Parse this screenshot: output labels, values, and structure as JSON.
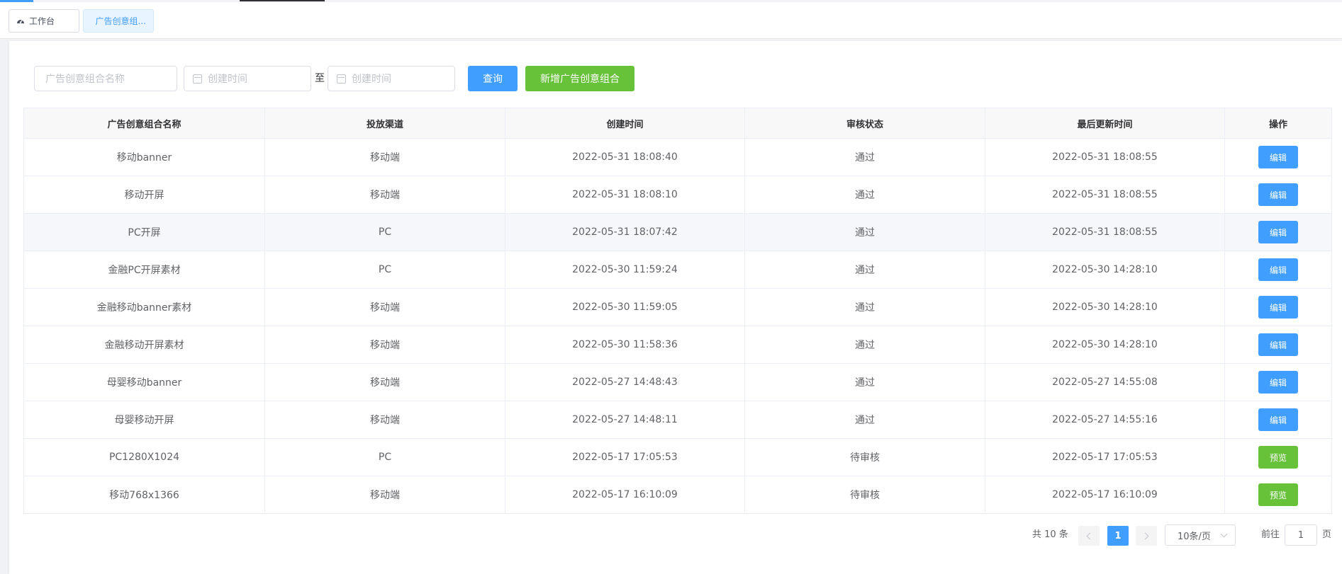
{
  "tags": [
    {
      "label": "工作台",
      "icon": "dashboard-icon",
      "active": false
    },
    {
      "label": "广告创意组...",
      "icon": "dashboard-icon",
      "active": true
    }
  ],
  "filters": {
    "name_placeholder": "广告创意组合名称",
    "start_placeholder": "创建时间",
    "range_separator": "至",
    "end_placeholder": "创建时间",
    "query_label": "查询",
    "add_label": "新增广告创意组合"
  },
  "table": {
    "columns": [
      "广告创意组合名称",
      "投放渠道",
      "创建时间",
      "审核状态",
      "最后更新时间",
      "操作"
    ],
    "rows": [
      {
        "name": "移动banner",
        "channel": "移动端",
        "created": "2022-05-31 18:08:40",
        "status": "通过",
        "updated": "2022-05-31 18:08:55",
        "action": "编辑"
      },
      {
        "name": "移动开屏",
        "channel": "移动端",
        "created": "2022-05-31 18:08:10",
        "status": "通过",
        "updated": "2022-05-31 18:08:55",
        "action": "编辑"
      },
      {
        "name": "PC开屏",
        "channel": "PC",
        "created": "2022-05-31 18:07:42",
        "status": "通过",
        "updated": "2022-05-31 18:08:55",
        "action": "编辑"
      },
      {
        "name": "金融PC开屏素材",
        "channel": "PC",
        "created": "2022-05-30 11:59:24",
        "status": "通过",
        "updated": "2022-05-30 14:28:10",
        "action": "编辑"
      },
      {
        "name": "金融移动banner素材",
        "channel": "移动端",
        "created": "2022-05-30 11:59:05",
        "status": "通过",
        "updated": "2022-05-30 14:28:10",
        "action": "编辑"
      },
      {
        "name": "金融移动开屏素材",
        "channel": "移动端",
        "created": "2022-05-30 11:58:36",
        "status": "通过",
        "updated": "2022-05-30 14:28:10",
        "action": "编辑"
      },
      {
        "name": "母婴移动banner",
        "channel": "移动端",
        "created": "2022-05-27 14:48:43",
        "status": "通过",
        "updated": "2022-05-27 14:55:08",
        "action": "编辑"
      },
      {
        "name": "母婴移动开屏",
        "channel": "移动端",
        "created": "2022-05-27 14:48:11",
        "status": "通过",
        "updated": "2022-05-27 14:55:16",
        "action": "编辑"
      },
      {
        "name": "PC1280X1024",
        "channel": "PC",
        "created": "2022-05-17 17:05:53",
        "status": "待审核",
        "updated": "2022-05-17 17:05:53",
        "action": "预览"
      },
      {
        "name": "移动768x1366",
        "channel": "移动端",
        "created": "2022-05-17 16:10:09",
        "status": "待审核",
        "updated": "2022-05-17 16:10:09",
        "action": "预览"
      }
    ]
  },
  "pagination": {
    "total_text": "共 10 条",
    "current_page": "1",
    "page_size": "10条/页",
    "jump_prefix": "前往",
    "jump_value": "1",
    "jump_suffix": "页"
  },
  "colors": {
    "primary": "#409eff",
    "success": "#67c23a"
  }
}
